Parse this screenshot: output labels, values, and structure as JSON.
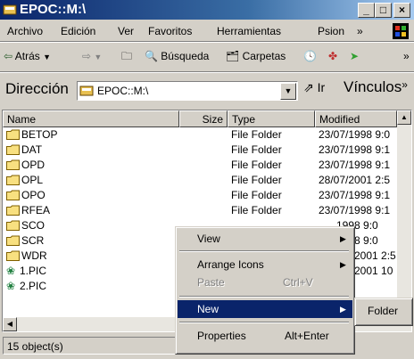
{
  "window": {
    "title": "EPOC::M:\\"
  },
  "title_buttons": {
    "minimize": "_",
    "maximize": "□",
    "close": "×"
  },
  "menubar": {
    "items": [
      "Archivo",
      "Edición",
      "Ver",
      "Favoritos",
      "Herramientas",
      "Psion"
    ],
    "overflow": "»"
  },
  "toolbar": {
    "back": "Atrás",
    "search": "Búsqueda",
    "folders": "Carpetas",
    "overflow": "»"
  },
  "address": {
    "label": "Dirección",
    "value": "EPOC::M:\\",
    "go": "Ir",
    "links": "Vínculos"
  },
  "columns": [
    "Name",
    "Size",
    "Type",
    "Modified"
  ],
  "rows": [
    {
      "name": "BETOP",
      "type": "File Folder",
      "modified": "23/07/1998 9:0"
    },
    {
      "name": "DAT",
      "type": "File Folder",
      "modified": "23/07/1998 9:1"
    },
    {
      "name": "OPD",
      "type": "File Folder",
      "modified": "23/07/1998 9:1"
    },
    {
      "name": "OPL",
      "type": "File Folder",
      "modified": "28/07/2001 2:5"
    },
    {
      "name": "OPO",
      "type": "File Folder",
      "modified": "23/07/1998 9:1"
    },
    {
      "name": "RFEA",
      "type": "File Folder",
      "modified": "23/07/1998 9:1"
    },
    {
      "name": "SCO",
      "type": "",
      "modified": "1998 9:0"
    },
    {
      "name": "SCR",
      "type": "",
      "modified": "1998 9:0"
    },
    {
      "name": "WDR",
      "type": "",
      "modified": "2001 2:5"
    },
    {
      "name": "1.PIC",
      "type": "",
      "modified": "2001 10"
    },
    {
      "name": "2.PIC",
      "type": "",
      "modified": ""
    }
  ],
  "context_menu": {
    "view": "View",
    "arrange": "Arrange Icons",
    "paste": "Paste",
    "paste_shortcut": "Ctrl+V",
    "new": "New",
    "properties": "Properties",
    "properties_shortcut": "Alt+Enter"
  },
  "submenu": {
    "folder": "Folder"
  },
  "status": {
    "text": "15 object(s)"
  },
  "colors": {
    "titlebar": "#0a246a",
    "highlight": "#0a246a",
    "face": "#d4d0c8"
  }
}
